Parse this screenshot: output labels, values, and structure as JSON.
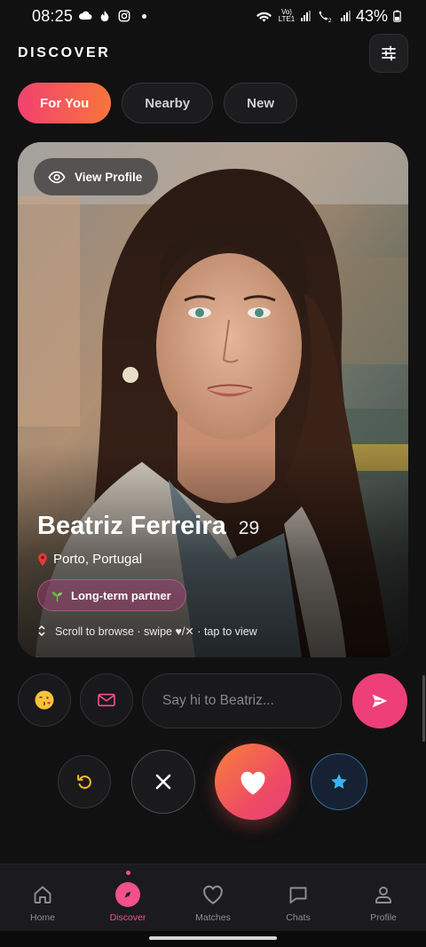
{
  "status_bar": {
    "time": "08:25",
    "network": "Vo) LTE1",
    "battery": "43%"
  },
  "header": {
    "title": "DISCOVER",
    "filter_icon": "sliders-icon"
  },
  "tabs": [
    {
      "label": "For You",
      "active": true
    },
    {
      "label": "Nearby",
      "active": false
    },
    {
      "label": "New",
      "active": false
    }
  ],
  "card": {
    "view_profile_label": "View Profile",
    "name": "Beatriz Ferreira",
    "age": "29",
    "location": "Porto, Portugal",
    "goal": "Long-term partner",
    "hint": "Scroll to browse · swipe ♥/✕ · tap to view"
  },
  "message": {
    "placeholder": "Say hi to Beatriz..."
  },
  "bottom_nav": [
    {
      "label": "Home",
      "icon": "home-icon",
      "active": false
    },
    {
      "label": "Discover",
      "icon": "compass-icon",
      "active": true
    },
    {
      "label": "Matches",
      "icon": "heart-outline-icon",
      "active": false
    },
    {
      "label": "Chats",
      "icon": "chat-bubble-icon",
      "active": false
    },
    {
      "label": "Profile",
      "icon": "user-icon",
      "active": false
    }
  ],
  "colors": {
    "accent": "#f2508c",
    "gradient_start": "#f2416f",
    "gradient_end": "#f7763c",
    "super_like": "#3ab4f2",
    "undo": "#f5b82e"
  }
}
